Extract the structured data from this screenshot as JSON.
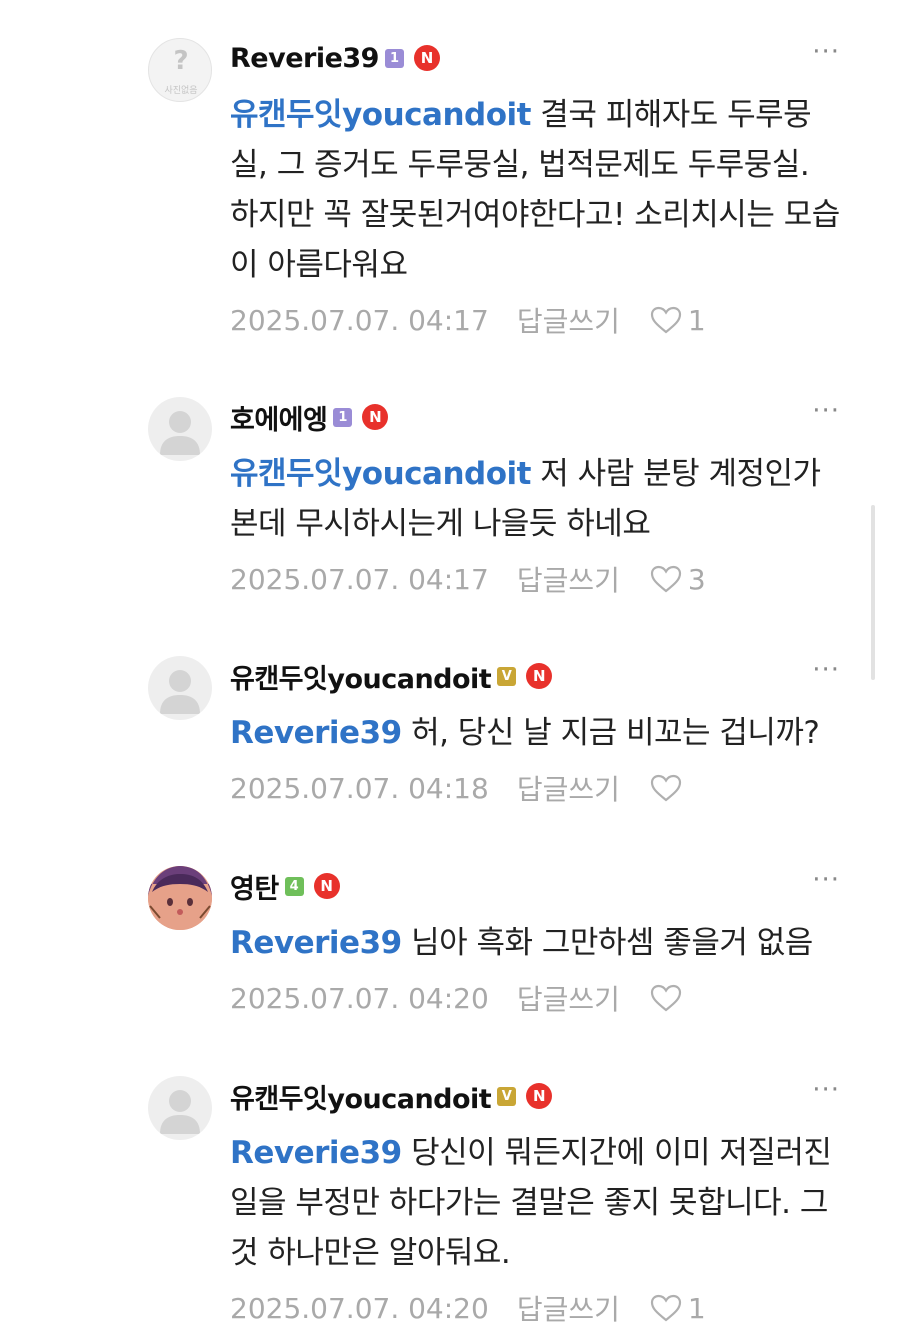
{
  "comments": [
    {
      "nickname": "Reverie39",
      "level": "1",
      "level_color": "#9a8cd6",
      "new_badge": "N",
      "more": "···",
      "mention": "유캔두잇youcandoit",
      "text": " 결국 피해자도 두루뭉실, 그 증거도 두루뭉실, 법적문제도 두루뭉실. 하지만 꼭 잘못된거여야한다고! 소리치시는 모습이 아름다워요",
      "date": "2025.07.07. 04:17",
      "reply_label": "답글쓰기",
      "likes": "1",
      "avatar": "default-question"
    },
    {
      "nickname": "호에에엥",
      "level": "1",
      "level_color": "#9a8cd6",
      "new_badge": "N",
      "more": "···",
      "mention": "유캔두잇youcandoit",
      "text": " 저 사람 분탕 계정인가본데 무시하시는게 나을듯 하네요",
      "date": "2025.07.07. 04:17",
      "reply_label": "답글쓰기",
      "likes": "3",
      "avatar": "default-person"
    },
    {
      "nickname": "유캔두잇youcandoit",
      "level": "V",
      "level_color": "#c9a635",
      "new_badge": "N",
      "more": "···",
      "mention": "Reverie39",
      "text": " 허, 당신 날 지금 비꼬는 겁니까?",
      "date": "2025.07.07. 04:18",
      "reply_label": "답글쓰기",
      "likes": "",
      "avatar": "default-person"
    },
    {
      "nickname": "영탄",
      "level": "4",
      "level_color": "#6fbf5a",
      "new_badge": "N",
      "more": "···",
      "mention": "Reverie39",
      "text": " 님아 흑화 그만하셈 좋을거 없음",
      "date": "2025.07.07. 04:20",
      "reply_label": "답글쓰기",
      "likes": "",
      "avatar": "character"
    },
    {
      "nickname": "유캔두잇youcandoit",
      "level": "V",
      "level_color": "#c9a635",
      "new_badge": "N",
      "more": "···",
      "mention": "Reverie39",
      "text": " 당신이 뭐든지간에 이미 저질러진 일을 부정만 하다가는 결말은 좋지 못합니다. 그것 하나만은 알아둬요.",
      "date": "2025.07.07. 04:20",
      "reply_label": "답글쓰기",
      "likes": "1",
      "avatar": "default-person"
    }
  ],
  "avatar_placeholder_text": "사진없음"
}
